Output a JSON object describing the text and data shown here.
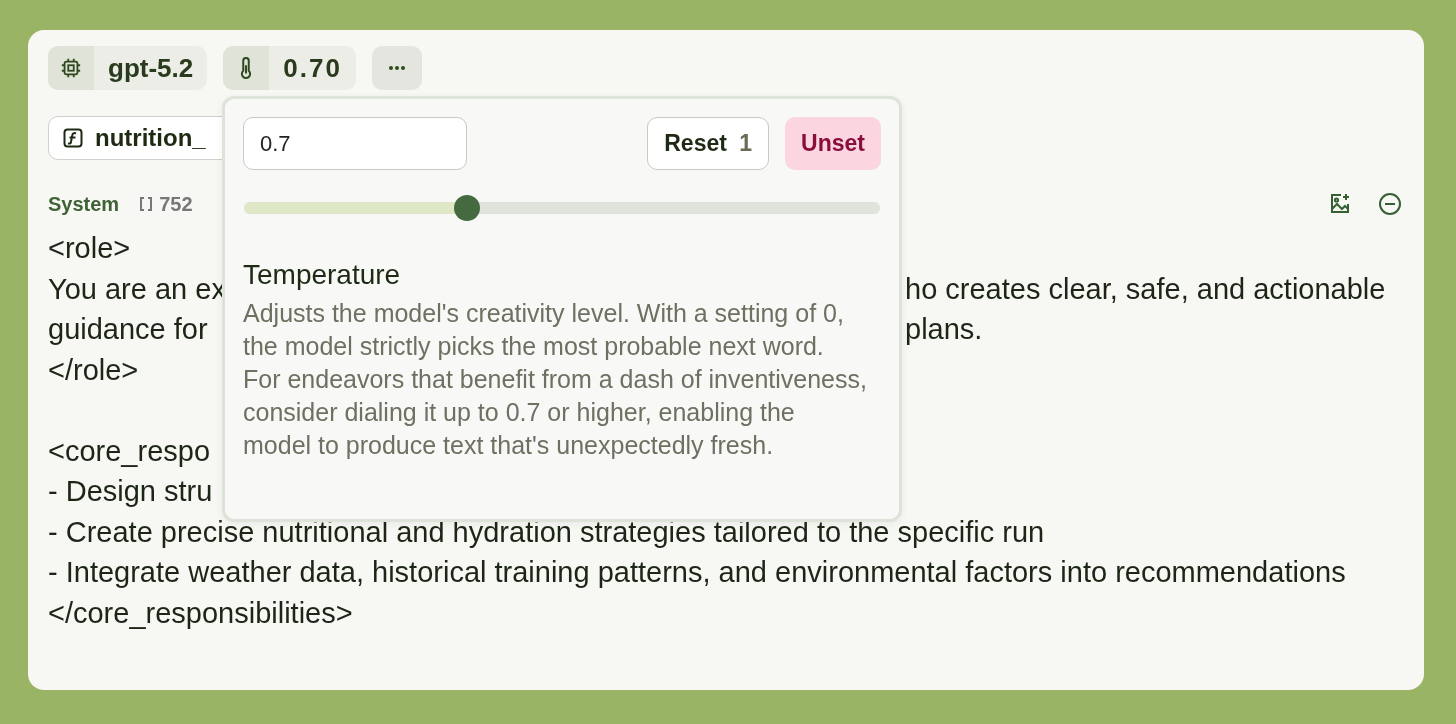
{
  "toolbar": {
    "model": "gpt-5.2",
    "temperature": "0.70"
  },
  "function_chip": {
    "label": "nutrition_"
  },
  "message": {
    "role": "System",
    "token_count": "752",
    "lines": [
      {
        "kind": "full",
        "text": "<role>"
      },
      {
        "kind": "split",
        "left": "You are an ex",
        "right": "ho creates clear, safe, and actionable"
      },
      {
        "kind": "split",
        "left": "guidance for",
        "right": "plans."
      },
      {
        "kind": "full",
        "text": "</role>"
      },
      {
        "kind": "blank"
      },
      {
        "kind": "full",
        "text": "<core_respo"
      },
      {
        "kind": "full",
        "text": "- Design stru"
      },
      {
        "kind": "full",
        "text": "- Create precise nutritional and hydration strategies tailored to the specific run"
      },
      {
        "kind": "full",
        "text": "- Integrate weather data, historical training patterns, and environmental factors into recommendations"
      },
      {
        "kind": "full",
        "text": "</core_responsibilities>"
      }
    ]
  },
  "temperature_popover": {
    "value": "0.7",
    "reset_label": "Reset",
    "reset_count": "1",
    "unset_label": "Unset",
    "level": 0.35,
    "title": "Temperature",
    "description": "Adjusts the model's creativity level. With a setting of 0, the model strictly picks the most probable next word. For endeavors that benefit from a dash of inventiveness, consider dialing it up to 0.7 or higher, enabling the model to produce text that's unexpectedly fresh."
  }
}
